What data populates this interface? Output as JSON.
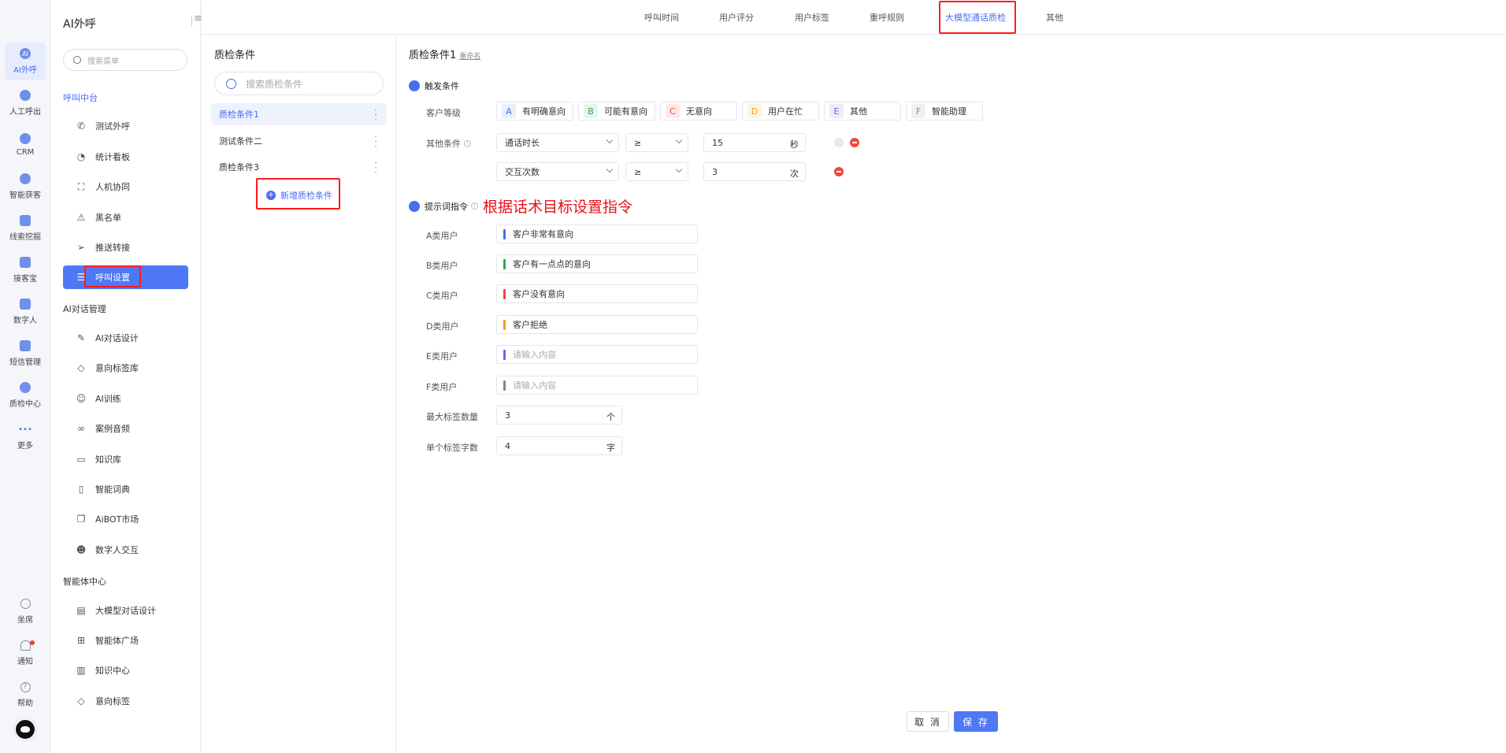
{
  "rail": {
    "items": [
      {
        "label": "AI外呼",
        "glyph": "AI"
      },
      {
        "label": "人工呼出",
        "glyph": ""
      },
      {
        "label": "CRM",
        "glyph": ""
      },
      {
        "label": "智能获客",
        "glyph": ""
      },
      {
        "label": "线索挖掘",
        "glyph": ""
      },
      {
        "label": "接客宝",
        "glyph": ""
      },
      {
        "label": "数字人",
        "glyph": ""
      },
      {
        "label": "短信管理",
        "glyph": ""
      },
      {
        "label": "质检中心",
        "glyph": ""
      },
      {
        "label": "更多",
        "glyph": "•••"
      }
    ],
    "bottom": [
      {
        "label": "坐席",
        "glyph": ""
      },
      {
        "label": "通知",
        "glyph": ""
      },
      {
        "label": "帮助",
        "glyph": "?"
      }
    ]
  },
  "menu": {
    "title": "AI外呼",
    "search_placeholder": "搜索菜单",
    "group1": "呼叫中台",
    "group1_items": [
      {
        "label": "测试外呼",
        "icon": "phone-icon",
        "glyph": "✆"
      },
      {
        "label": "统计看板",
        "icon": "pie-chart-icon",
        "glyph": "◔"
      },
      {
        "label": "人机协同",
        "icon": "scan-face-icon",
        "glyph": "⛶"
      },
      {
        "label": "黑名单",
        "icon": "warning-icon",
        "glyph": "⚠"
      },
      {
        "label": "推送转接",
        "icon": "send-icon",
        "glyph": "➢"
      },
      {
        "label": "呼叫设置",
        "icon": "sliders-icon",
        "glyph": "☰"
      }
    ],
    "group2": "AI对话管理",
    "group2_items": [
      {
        "label": "AI对话设计",
        "icon": "pen-icon",
        "glyph": "✎"
      },
      {
        "label": "意向标签库",
        "icon": "tag-icon",
        "glyph": "◇"
      },
      {
        "label": "AI训练",
        "icon": "chat-bot-icon",
        "glyph": "☺"
      },
      {
        "label": "案例音频",
        "icon": "voicemail-icon",
        "glyph": "∞"
      },
      {
        "label": "知识库",
        "icon": "laptop-icon",
        "glyph": "▭"
      },
      {
        "label": "智能词典",
        "icon": "book-icon",
        "glyph": "▯"
      },
      {
        "label": "AiBOT市场",
        "icon": "copy-icon",
        "glyph": "❐"
      },
      {
        "label": "数字人交互",
        "icon": "ghost-icon",
        "glyph": "☻"
      }
    ],
    "group3": "智能体中心",
    "group3_items": [
      {
        "label": "大模型对话设计",
        "icon": "chart-board-icon",
        "glyph": "▤"
      },
      {
        "label": "智能体广场",
        "icon": "grid-icon",
        "glyph": "⊞"
      },
      {
        "label": "知识中心",
        "icon": "open-book-icon",
        "glyph": "▥"
      },
      {
        "label": "意向标签",
        "icon": "tag-icon",
        "glyph": "◇"
      }
    ]
  },
  "tabs": [
    "呼叫时间",
    "用户评分",
    "用户标签",
    "重呼规则",
    "大模型通话质检",
    "其他"
  ],
  "conditions": {
    "title": "质检条件",
    "search_placeholder": "搜索质检条件",
    "items": [
      "质检条件1",
      "测试条件二",
      "质检条件3"
    ],
    "add_label": "新增质检条件"
  },
  "form": {
    "title": "质检条件1",
    "rename": "重命名",
    "trigger_title": "触发条件",
    "level_label": "客户等级",
    "levels": [
      {
        "letter": "A",
        "label": "有明确意向",
        "color": "#4a6df0",
        "bg": "#e9eefd"
      },
      {
        "letter": "B",
        "label": "可能有意向",
        "color": "#2fa84f",
        "bg": "#e6f6ea"
      },
      {
        "letter": "C",
        "label": "无意向",
        "color": "#f2463c",
        "bg": "#fde9e8"
      },
      {
        "letter": "D",
        "label": "用户在忙",
        "color": "#f0a020",
        "bg": "#fdf3e1"
      },
      {
        "letter": "E",
        "label": "其他",
        "color": "#7a5cf0",
        "bg": "#efeafd"
      },
      {
        "letter": "F",
        "label": "智能助理",
        "color": "#888888",
        "bg": "#f0f0f0"
      }
    ],
    "other_label": "其他条件",
    "rules": [
      {
        "field": "通话时长",
        "op": "≥",
        "value": "15",
        "unit": "秒"
      },
      {
        "field": "交互次数",
        "op": "≥",
        "value": "3",
        "unit": "次"
      }
    ],
    "prompt_title": "提示词指令",
    "annotation": "根据话术目标设置指令",
    "prompts": [
      {
        "label": "A类用户",
        "value": "客户非常有意向",
        "color": "#4a6df0"
      },
      {
        "label": "B类用户",
        "value": "客户有一点点的意向",
        "color": "#2fa84f"
      },
      {
        "label": "C类用户",
        "value": "客户没有意向",
        "color": "#f2463c"
      },
      {
        "label": "D类用户",
        "value": "客户拒绝",
        "color": "#f0a020"
      },
      {
        "label": "E类用户",
        "value": "",
        "color": "#7a5cf0"
      },
      {
        "label": "F类用户",
        "value": "",
        "color": "#888888"
      }
    ],
    "placeholder": "请输入内容",
    "max_tags_label": "最大标签数量",
    "max_tags_value": "3",
    "max_tags_unit": "个",
    "tag_chars_label": "单个标签字数",
    "tag_chars_value": "4",
    "tag_chars_unit": "字",
    "cancel": "取 消",
    "save": "保 存"
  }
}
